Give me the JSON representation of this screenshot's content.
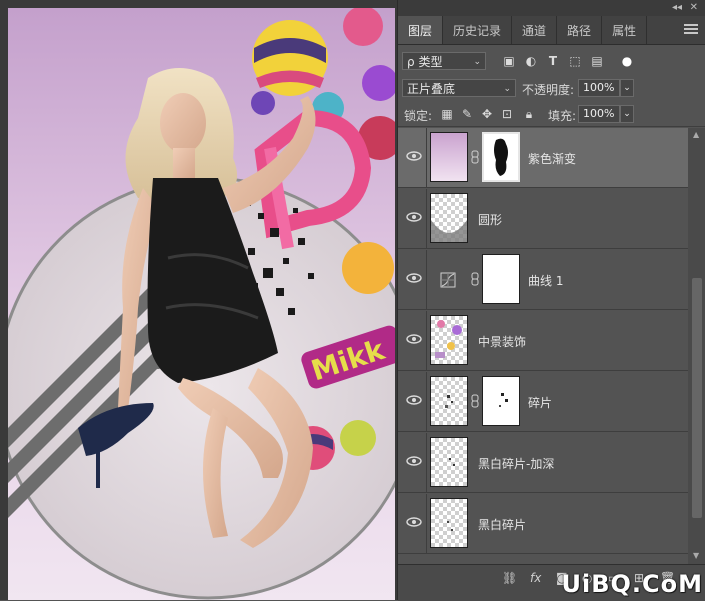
{
  "panel": {
    "tabs": [
      {
        "label": "图层",
        "active": true
      },
      {
        "label": "历史记录",
        "active": false
      },
      {
        "label": "通道",
        "active": false
      },
      {
        "label": "路径",
        "active": false
      },
      {
        "label": "属性",
        "active": false
      }
    ],
    "filter": {
      "search_symbol": "ρ",
      "kind_label": "类型"
    },
    "blend_mode": "正片叠底",
    "opacity": {
      "label": "不透明度:",
      "value": "100%"
    },
    "lock": {
      "label": "锁定:"
    },
    "fill": {
      "label": "填充:",
      "value": "100%"
    }
  },
  "layers": [
    {
      "name": "紫色渐变",
      "selected": true,
      "has_mask": true,
      "visible": true
    },
    {
      "name": "圆形",
      "selected": false,
      "has_mask": false,
      "visible": true
    },
    {
      "name": "曲线 1",
      "selected": false,
      "has_mask": true,
      "adjustment": true,
      "visible": true
    },
    {
      "name": "中景装饰",
      "selected": false,
      "has_mask": false,
      "visible": true
    },
    {
      "name": "碎片",
      "selected": false,
      "has_mask": true,
      "visible": true
    },
    {
      "name": "黑白碎片-加深",
      "selected": false,
      "has_mask": false,
      "visible": true
    },
    {
      "name": "黑白碎片",
      "selected": false,
      "has_mask": false,
      "visible": true
    }
  ],
  "artwork": {
    "logo_text": "Mikk"
  },
  "watermark": "UiBQ.CoM",
  "colors": {
    "panel_bg": "#535353",
    "selected_row": "#6b6b6b",
    "purple_gradient": "#d9bddd"
  },
  "icons": [
    "search-icon",
    "image-filter-icon",
    "adjust-filter-icon",
    "type-filter-icon",
    "shape-filter-icon",
    "smart-filter-icon",
    "lock-pixels-icon",
    "lock-paint-icon",
    "lock-move-icon",
    "lock-artboard-icon",
    "lock-all-icon",
    "eye-icon",
    "chain-link-icon",
    "link-layers-icon",
    "fx-icon",
    "add-mask-icon",
    "new-fill-icon",
    "new-group-icon",
    "new-layer-icon",
    "trash-icon"
  ]
}
